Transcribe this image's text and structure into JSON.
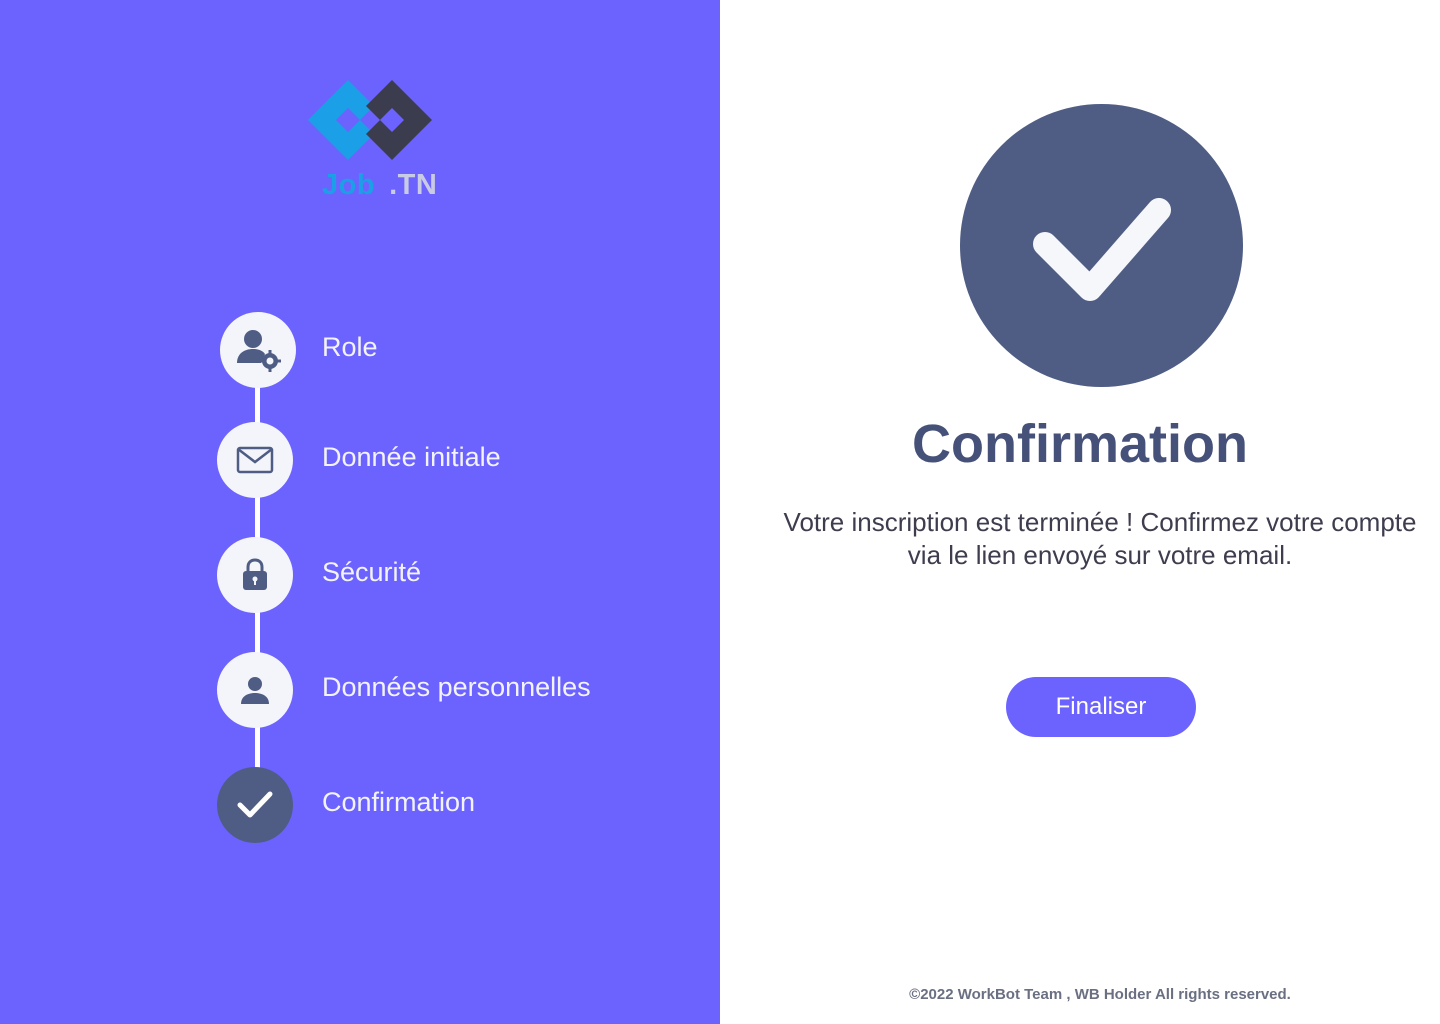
{
  "brand": {
    "name_part1": "Job",
    "name_part2": ".TN"
  },
  "colors": {
    "accent": "#6c63ff",
    "done_step": "#4f5d85",
    "title": "#46517a"
  },
  "stepper": {
    "steps": [
      {
        "label": "Role",
        "icon": "user-gear-icon",
        "state": "complete"
      },
      {
        "label": "Donnée initiale",
        "icon": "envelope-icon",
        "state": "complete"
      },
      {
        "label": "Sécurité",
        "icon": "lock-icon",
        "state": "complete"
      },
      {
        "label": "Données personnelles",
        "icon": "person-icon",
        "state": "complete"
      },
      {
        "label": "Confirmation",
        "icon": "checkmark-icon",
        "state": "current"
      }
    ]
  },
  "main": {
    "title": "Confirmation",
    "message": "Votre inscription est terminée ! Confirmez votre compte via le lien envoyé sur votre email.",
    "finalize_label": "Finaliser"
  },
  "footer": {
    "text": "©2022 WorkBot Team , WB Holder All rights reserved."
  }
}
